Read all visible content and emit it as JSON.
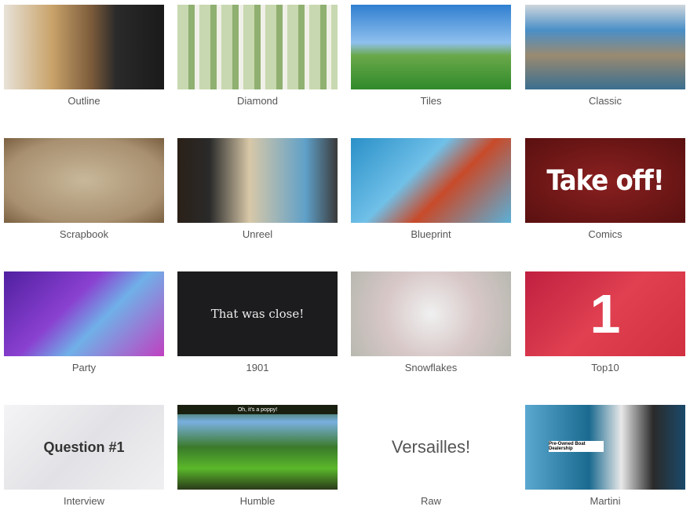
{
  "themes": [
    {
      "label": "Outline",
      "bg": "linear-gradient(90deg,#e8e2d8 0%,#c9a36a 30%,#7a5a3a 55%,#2a2a2a 70%,#1a1a1a 100%)"
    },
    {
      "label": "Diamond",
      "bg": "repeating-linear-gradient(90deg,#c8d8b0 0 14px,#8fb070 14px 22px,#f0f0e8 22px 28px),radial-gradient(#d8234a,#6a8a40)"
    },
    {
      "label": "Tiles",
      "bg": "linear-gradient(180deg,#2f7fd0 0%,#8fc0ee 45%,#6aa84a 60%,#2f8a2a 100%)"
    },
    {
      "label": "Classic",
      "bg": "linear-gradient(180deg,#cfd6dc 0%,#4a8fc8 30%,#9a8a70 60%,#3a6f90 100%)"
    },
    {
      "label": "Scrapbook",
      "bg": "radial-gradient(ellipse at center,#c8b89a 0%,#a89070 70%,#7a6040 100%)"
    },
    {
      "label": "Unreel",
      "bg": "linear-gradient(90deg,#2a2018 0%,#2a2a2a 20%,#d8c8a8 45%,#5fa0c8 80%,#3a3a3a 100%)"
    },
    {
      "label": "Blueprint",
      "bg": "linear-gradient(135deg,#2a90c8 0%,#70c0e8 40%,#c84a2a 60%,#5ab0d8 100%)"
    },
    {
      "label": "Comics",
      "bg": "radial-gradient(ellipse at center,#8a2020 0%,#5a1010 100%)",
      "text": "Take off!"
    },
    {
      "label": "Party",
      "bg": "linear-gradient(135deg,#5020a0 0%,#8a40d0 40%,#70b0e8 60%,#c040c0 100%)"
    },
    {
      "label": "1901",
      "bg": "#1c1c1e",
      "text": "That was close!"
    },
    {
      "label": "Snowflakes",
      "bg": "radial-gradient(circle,#f0f0f0 0%,#d8c8c8 50%,#b8b8b0 100%)"
    },
    {
      "label": "Top10",
      "bg": "linear-gradient(135deg,#c02040 0%,#e04050 50%,#d03040 100%)",
      "text": "1"
    },
    {
      "label": "Interview",
      "bg": "linear-gradient(135deg,#f4f4f6 0%,#e2e2e6 50%,#f0f0f2 100%)",
      "text": "Question #1"
    },
    {
      "label": "Humble",
      "bg": "linear-gradient(180deg,#2a5a1a 0%,#7ab0e0 20%,#3a7a2a 50%,#5ab82a 75%,#2a3a1a 100%)",
      "text": "Oh, it's a poppy!"
    },
    {
      "label": "Raw",
      "bg": "#ffffff",
      "text": "Versailles!"
    },
    {
      "label": "Martini",
      "bg": "linear-gradient(90deg,#5aa8d0 0%,#1a6a90 40%,#e8e8e8 60%,#2a2a2a 80%,#1a4a6a 100%)",
      "text": "Pre-Owned Boat Dealership"
    }
  ]
}
